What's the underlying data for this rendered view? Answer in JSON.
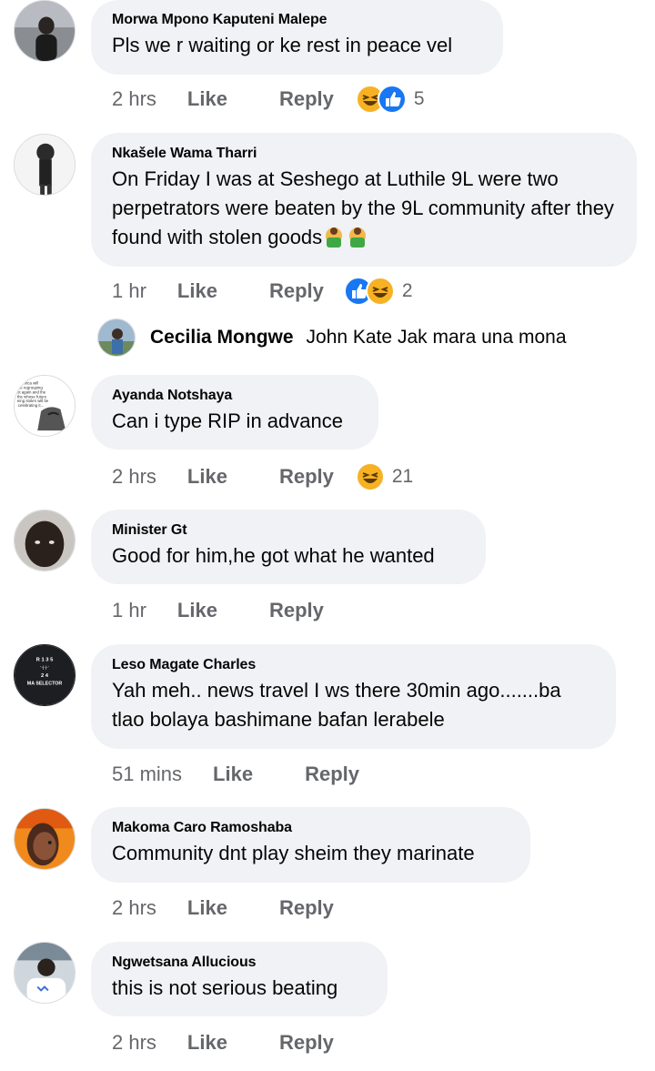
{
  "comments": [
    {
      "name": "Morwa Mpono Kaputeni Malepe",
      "text": "Pls we r waiting or ke rest in peace vel",
      "time": "2 hrs",
      "like": "Like",
      "reply": "Reply",
      "reaction_count": "5"
    },
    {
      "name": "Nkašele Wama Tharri",
      "text": "On Friday I was at Seshego at Luthile 9L were two perpetrators were beaten by the 9L community after they found with stolen goods",
      "time": "1 hr",
      "like": "Like",
      "reply": "Reply",
      "reaction_count": "2"
    },
    {
      "name": "Ayanda Notshaya",
      "text": "Can i type RIP in advance",
      "time": "2 hrs",
      "like": "Like",
      "reply": "Reply",
      "reaction_count": "21"
    },
    {
      "name": "Minister Gt",
      "text": "Good for him,he got what he wanted",
      "time": "1 hr",
      "like": "Like",
      "reply": "Reply"
    },
    {
      "name": "Leso Magate Charles",
      "text": "Yah meh.. news travel I ws there 30min ago.......ba tlao bolaya bashimane bafan lerabele",
      "time": "51 mins",
      "like": "Like",
      "reply": "Reply"
    },
    {
      "name": "Makoma Caro Ramoshaba",
      "text": "Community dnt play sheim they marinate",
      "time": "2 hrs",
      "like": "Like",
      "reply": "Reply"
    },
    {
      "name": "Ngwetsana Allucious",
      "text": "this is not serious beating",
      "time": "2 hrs",
      "like": "Like",
      "reply": "Reply"
    }
  ],
  "reply_preview": {
    "name": "Cecilia Mongwe",
    "text": "John Kate Jak mara una mona"
  },
  "avatar_text": {
    "ayanda": [
      "Africa will",
      "be regrouping",
      "ot again and the",
      "the whose future",
      "eing stolen will be",
      "celebrating it..."
    ],
    "leso": [
      "R 1 3 5",
      "'-|-|-'",
      "2 4",
      "MA SELECTOR"
    ]
  },
  "colors": {
    "bubble": "#f0f2f5",
    "meta": "#65676b",
    "like_blue": "#1877f2",
    "haha_yellow": "#f7b125"
  }
}
